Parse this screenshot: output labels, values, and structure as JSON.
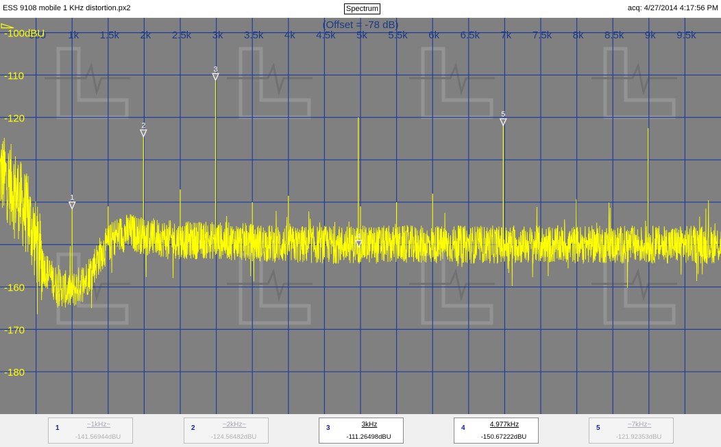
{
  "window": {
    "file_title": "ESS 9108 mobile 1 KHz distortion.px2",
    "mode_button": "Spectrum",
    "acq_time": "acq: 4/27/2014 4:17:56 PM"
  },
  "chart_data": {
    "type": "line",
    "title": "",
    "offset_label": "(Offset = -78 dB)",
    "xlabel": "",
    "ylabel": "",
    "xlim": [
      0,
      10000
    ],
    "ylim": [
      -190,
      -96.5
    ],
    "x_ticks": [
      500,
      1000,
      1500,
      2000,
      2500,
      3000,
      3500,
      4000,
      4500,
      5000,
      5500,
      6000,
      6500,
      7000,
      7500,
      8000,
      8500,
      9000,
      9500
    ],
    "x_tick_labels": [
      "500",
      "1k",
      "1.5k",
      "2k",
      "2.5k",
      "3k",
      "3.5k",
      "4k",
      "4.5k",
      "5k",
      "5.5k",
      "6k",
      "6.5k",
      "7k",
      "7.5k",
      "8k",
      "8.5k",
      "9k",
      "9.5k"
    ],
    "y_ticks": [
      -100,
      -110,
      -120,
      -130,
      -140,
      -150,
      -160,
      -170,
      -180
    ],
    "y_tick_labels": [
      "-100dBU",
      "-110",
      "-120",
      "",
      "",
      "",
      "-160",
      "-170",
      "-180"
    ],
    "grid": true,
    "colors": {
      "background": "#808080",
      "grid": "#1f3f9f",
      "trace": "#ffff00",
      "axis_text": "#ffff00",
      "tick_text": "#1a3a8a",
      "offset_text": "#1a3a8a",
      "marker": "#ffffff"
    },
    "noise_floor": [
      [
        0,
        -133
      ],
      [
        200,
        -137
      ],
      [
        400,
        -144
      ],
      [
        600,
        -155
      ],
      [
        800,
        -160
      ],
      [
        1000,
        -161
      ],
      [
        1200,
        -158
      ],
      [
        1400,
        -152
      ],
      [
        1600,
        -148
      ],
      [
        1800,
        -147
      ],
      [
        2000,
        -148
      ],
      [
        2500,
        -149
      ],
      [
        3000,
        -149
      ],
      [
        4000,
        -150
      ],
      [
        5000,
        -150
      ],
      [
        6000,
        -150
      ],
      [
        7000,
        -150
      ],
      [
        8000,
        -150
      ],
      [
        9000,
        -150
      ],
      [
        10000,
        -150
      ]
    ],
    "noise_amplitude_db": 4.5,
    "spurs": [
      {
        "x": 1000,
        "y": -141.6
      },
      {
        "x": 1500,
        "y": -141
      },
      {
        "x": 1990,
        "y": -124.6
      },
      {
        "x": 2500,
        "y": -137
      },
      {
        "x": 2990,
        "y": -111.3
      },
      {
        "x": 3500,
        "y": -140
      },
      {
        "x": 4000,
        "y": -138.5
      },
      {
        "x": 4970,
        "y": -120
      },
      {
        "x": 5000,
        "y": -141
      },
      {
        "x": 5500,
        "y": -140
      },
      {
        "x": 6000,
        "y": -138
      },
      {
        "x": 6980,
        "y": -121.9
      },
      {
        "x": 8990,
        "y": -122.5
      }
    ],
    "peak_markers": [
      {
        "id": "1",
        "x": 1000,
        "y": -141.56944
      },
      {
        "id": "2",
        "x": 1990,
        "y": -124.56482
      },
      {
        "id": "3",
        "x": 2990,
        "y": -111.26498
      },
      {
        "id": "4",
        "x": 4977,
        "y": -150.67222
      },
      {
        "id": "5",
        "x": 6980,
        "y": -121.92353
      }
    ],
    "level_marker": {
      "y": -100
    },
    "watermark": "logo"
  },
  "markers": [
    {
      "num": "1",
      "freq": "~1kHz~",
      "level": "-141.56944dBU",
      "active": false
    },
    {
      "num": "2",
      "freq": "~2kHz~",
      "level": "-124.56482dBU",
      "active": false
    },
    {
      "num": "3",
      "freq": "3kHz",
      "level": "-111.26498dBU",
      "active": true
    },
    {
      "num": "4",
      "freq": "4.977kHz",
      "level": "-150.67222dBU",
      "active": true
    },
    {
      "num": "5",
      "freq": "~7kHz~",
      "level": "-121.92353dBU",
      "active": false
    }
  ]
}
